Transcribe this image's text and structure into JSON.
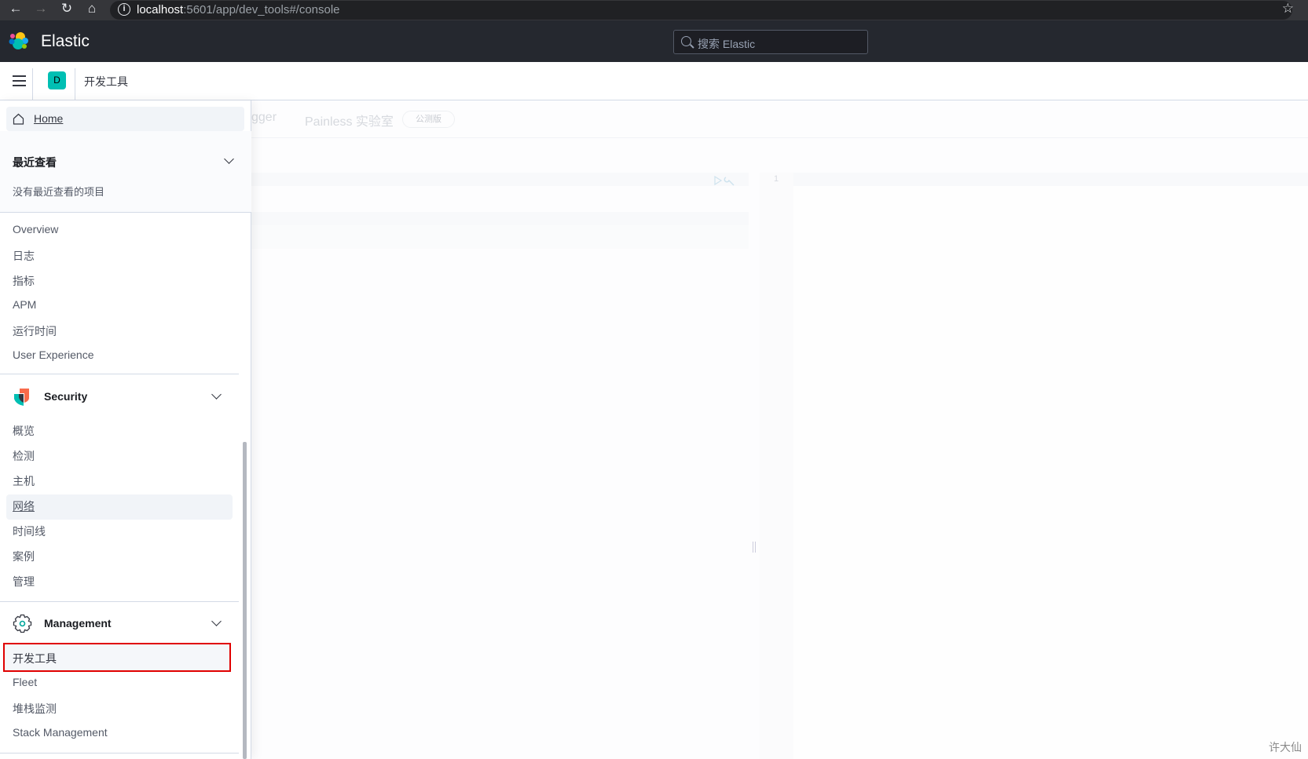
{
  "browser": {
    "url_host": "localhost",
    "url_rest": ":5601/app/dev_tools#/console",
    "icons": [
      "back-icon",
      "forward-icon",
      "reload-icon",
      "home-icon",
      "info-icon",
      "star-icon"
    ]
  },
  "header": {
    "brand": "Elastic",
    "search_placeholder": "搜索 Elastic"
  },
  "breadcrumb": {
    "space_badge": "D",
    "current": "开发工具"
  },
  "tabs": [
    {
      "label": "gger"
    },
    {
      "label": "Painless 实验室",
      "badge": "公测版"
    }
  ],
  "editor": {
    "line_number": "1"
  },
  "sidebar": {
    "home": "Home",
    "recent": {
      "title": "最近查看",
      "empty": "没有最近查看的项目"
    },
    "observability": [
      "Overview",
      "日志",
      "指标",
      "APM",
      "运行时间",
      "User Experience"
    ],
    "security": {
      "title": "Security",
      "items": [
        "概览",
        "检测",
        "主机",
        "网络",
        "时间线",
        "案例",
        "管理"
      ]
    },
    "management": {
      "title": "Management",
      "items": [
        "开发工具",
        "Fleet",
        "堆栈监测",
        "Stack Management"
      ]
    }
  },
  "watermark": "许大仙",
  "colors": {
    "header": "#25282f",
    "space_badge": "#00bfb3",
    "highlight_box": "#e00000"
  }
}
